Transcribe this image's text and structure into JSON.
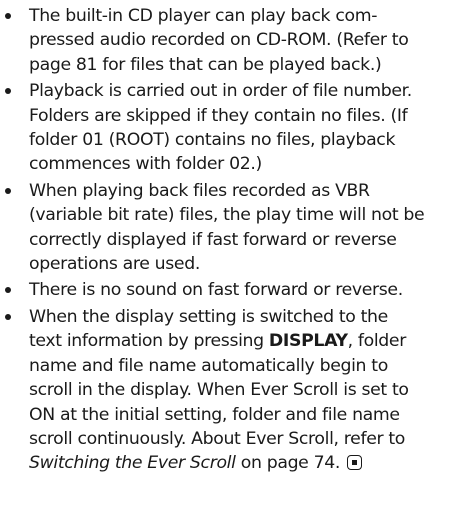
{
  "notes": [
    {
      "lines": [
        "The built-in CD player can play back com-",
        "pressed audio recorded on CD-ROM. (Refer to",
        "page 81 for files that can be played back.)"
      ]
    },
    {
      "lines": [
        "Playback is carried out in order of file number.",
        "Folders are skipped if they contain no files. (If",
        "folder 01 (ROOT) contains no files, playback",
        "commences with folder 02.)"
      ]
    },
    {
      "lines": [
        "When playing back files recorded as VBR",
        "(variable bit rate) files, the play time will not be",
        "correctly displayed if fast forward or reverse",
        "operations are used."
      ]
    },
    {
      "lines": [
        "There is no sound on fast forward or reverse."
      ]
    },
    {
      "line1": {
        "text": "When the display setting is switched to the"
      },
      "line2": {
        "before": "text information by pressing ",
        "bold": "DISPLAY",
        "after": ", folder"
      },
      "lines_middle": [
        "name and file name automatically begin to",
        "scroll in the display. When Ever Scroll is set to",
        "ON at the initial setting, folder and file name",
        "scroll continuously. About Ever Scroll, refer to"
      ],
      "last_line": {
        "italic": "Switching the Ever Scroll",
        "after": " on page 74."
      },
      "end_icon": "end-of-section-icon"
    }
  ]
}
